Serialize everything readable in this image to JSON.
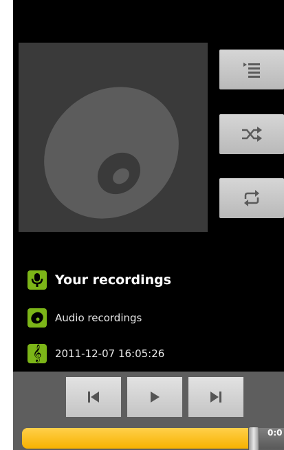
{
  "now_playing": {
    "title": "Your recordings",
    "album": "Audio recordings",
    "date": "2011-12-07 16:05:26",
    "album_art_icon": "cd-disc-icon"
  },
  "side_controls": [
    {
      "name": "queue-list-button",
      "icon": "list-icon"
    },
    {
      "name": "shuffle-button",
      "icon": "shuffle-icon"
    },
    {
      "name": "repeat-button",
      "icon": "repeat-icon"
    }
  ],
  "transport": {
    "time_display": "0:0",
    "progress_fraction": 0.84
  },
  "colors": {
    "accent_green": "#7cb518",
    "progress_orange": "#f7b200",
    "background": "#000000"
  }
}
